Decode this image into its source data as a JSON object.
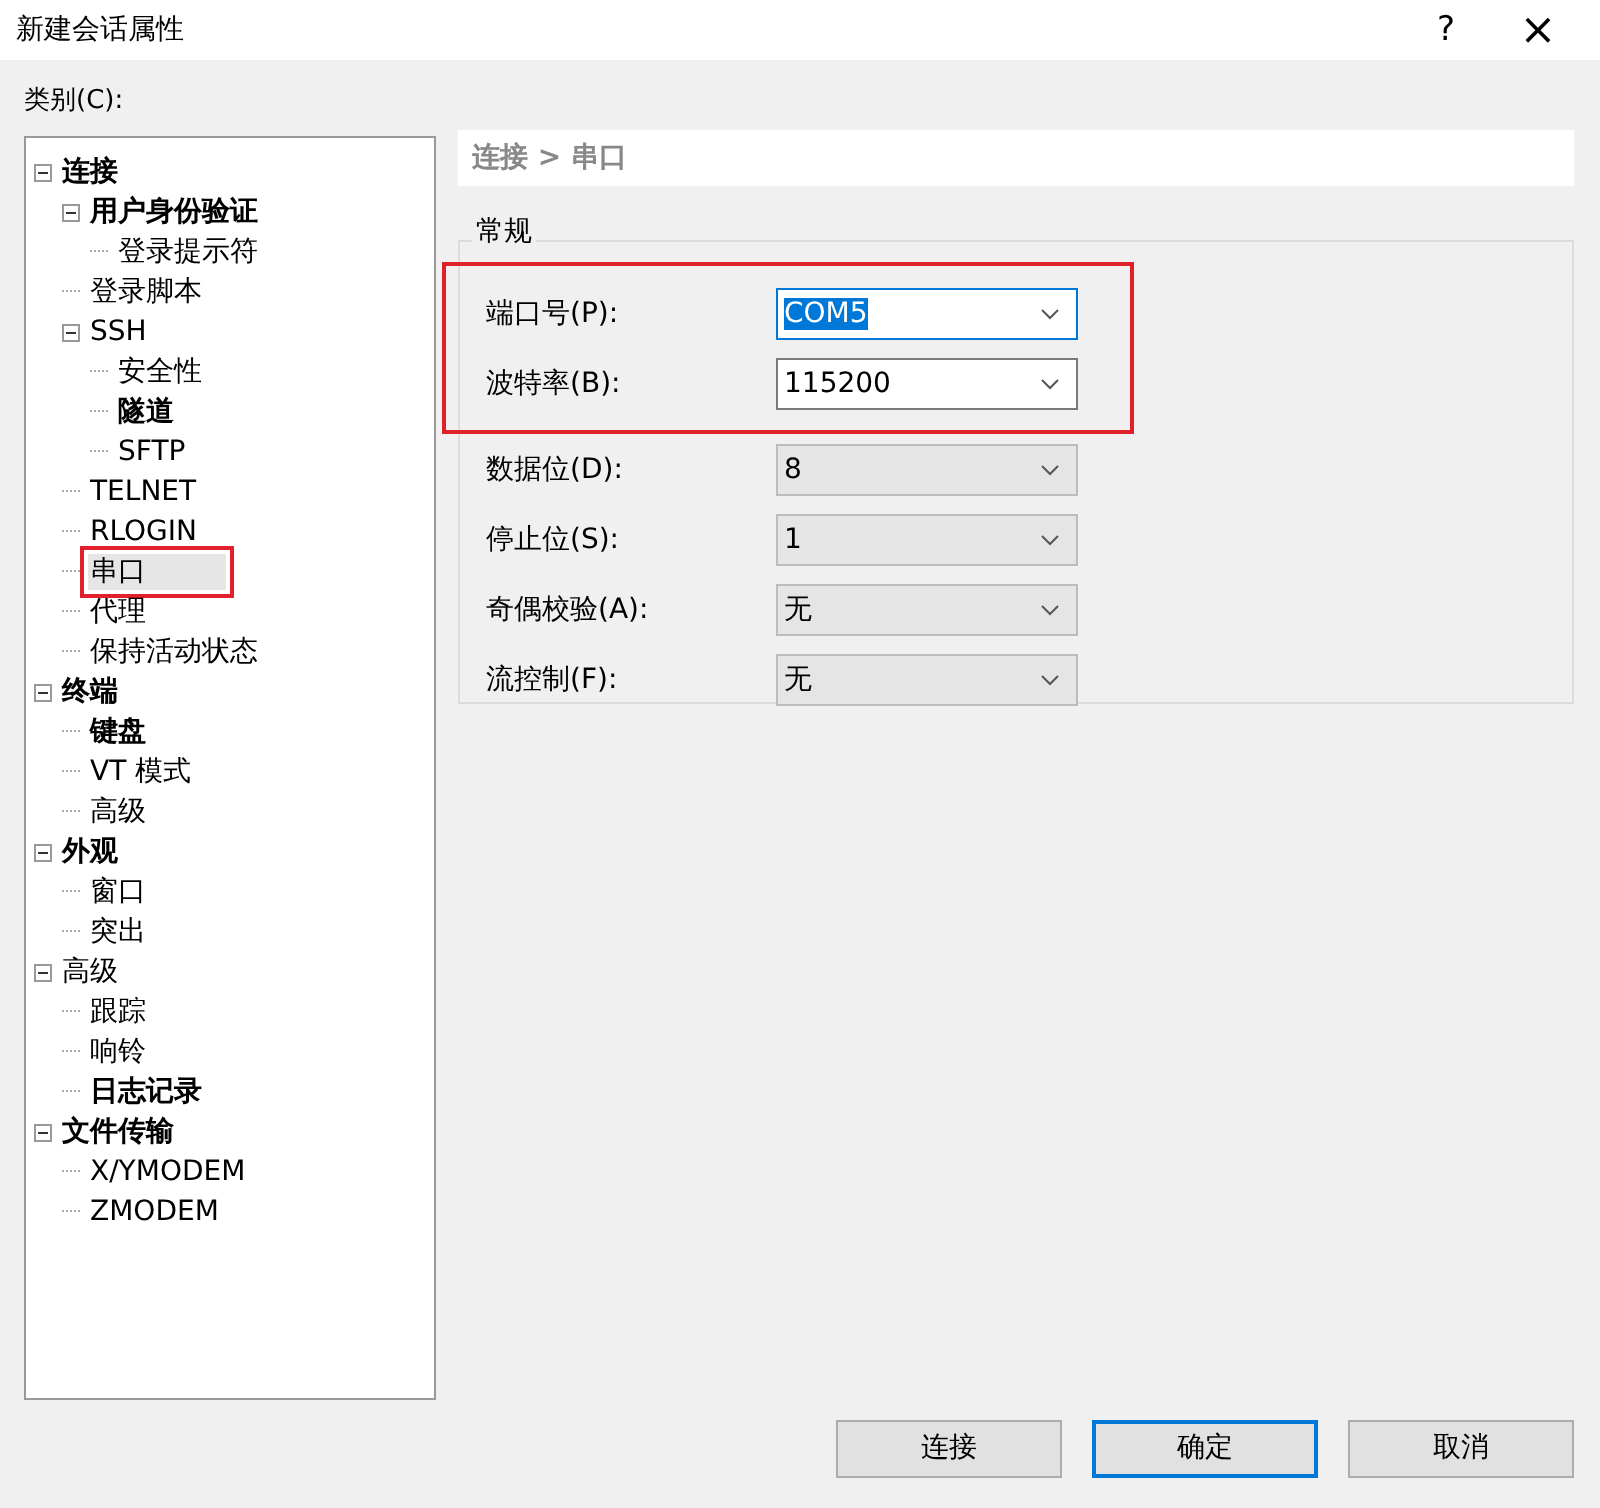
{
  "window": {
    "title": "新建会话属性",
    "help": "?",
    "close": "×"
  },
  "category_label": "类别(C):",
  "tree": [
    {
      "label": "连接",
      "bold": true,
      "expanded": true,
      "selected": false,
      "highlighted": false,
      "children": [
        {
          "label": "用户身份验证",
          "bold": true,
          "expanded": true,
          "selected": false,
          "highlighted": false,
          "children": [
            {
              "label": "登录提示符",
              "bold": false,
              "selected": false,
              "highlighted": false
            }
          ]
        },
        {
          "label": "登录脚本",
          "bold": false,
          "selected": false,
          "highlighted": false
        },
        {
          "label": "SSH",
          "bold": false,
          "expanded": true,
          "selected": false,
          "highlighted": false,
          "children": [
            {
              "label": "安全性",
              "bold": false,
              "selected": false,
              "highlighted": false
            },
            {
              "label": "隧道",
              "bold": true,
              "selected": false,
              "highlighted": false
            },
            {
              "label": "SFTP",
              "bold": false,
              "selected": false,
              "highlighted": false
            }
          ]
        },
        {
          "label": "TELNET",
          "bold": false,
          "selected": false,
          "highlighted": false
        },
        {
          "label": "RLOGIN",
          "bold": false,
          "selected": false,
          "highlighted": false
        },
        {
          "label": "串口",
          "bold": false,
          "selected": true,
          "highlighted": true
        },
        {
          "label": "代理",
          "bold": false,
          "selected": false,
          "highlighted": false
        },
        {
          "label": "保持活动状态",
          "bold": false,
          "selected": false,
          "highlighted": false
        }
      ]
    },
    {
      "label": "终端",
      "bold": true,
      "expanded": true,
      "selected": false,
      "highlighted": false,
      "children": [
        {
          "label": "键盘",
          "bold": true,
          "selected": false,
          "highlighted": false
        },
        {
          "label": "VT 模式",
          "bold": false,
          "selected": false,
          "highlighted": false
        },
        {
          "label": "高级",
          "bold": false,
          "selected": false,
          "highlighted": false
        }
      ]
    },
    {
      "label": "外观",
      "bold": true,
      "expanded": true,
      "selected": false,
      "highlighted": false,
      "children": [
        {
          "label": "窗口",
          "bold": false,
          "selected": false,
          "highlighted": false
        },
        {
          "label": "突出",
          "bold": false,
          "selected": false,
          "highlighted": false
        }
      ]
    },
    {
      "label": "高级",
      "bold": false,
      "expanded": true,
      "selected": false,
      "highlighted": false,
      "children": [
        {
          "label": "跟踪",
          "bold": false,
          "selected": false,
          "highlighted": false
        },
        {
          "label": "响铃",
          "bold": false,
          "selected": false,
          "highlighted": false
        },
        {
          "label": "日志记录",
          "bold": true,
          "selected": false,
          "highlighted": false
        }
      ]
    },
    {
      "label": "文件传输",
      "bold": true,
      "expanded": true,
      "selected": false,
      "highlighted": false,
      "children": [
        {
          "label": "X/YMODEM",
          "bold": false,
          "selected": false,
          "highlighted": false
        },
        {
          "label": "ZMODEM",
          "bold": false,
          "selected": false,
          "highlighted": false
        }
      ]
    }
  ],
  "breadcrumb": "连接 > 串口",
  "group_title": "常规",
  "field_groups": [
    {
      "highlighted": true,
      "fields": [
        {
          "label": "端口号(P):",
          "value": "COM5",
          "editable": true,
          "focused": true,
          "text_selected": true
        },
        {
          "label": "波特率(B):",
          "value": "115200",
          "editable": true,
          "focused": false,
          "text_selected": false
        }
      ]
    },
    {
      "highlighted": false,
      "fields": [
        {
          "label": "数据位(D):",
          "value": "8",
          "editable": false,
          "focused": false,
          "text_selected": false
        },
        {
          "label": "停止位(S):",
          "value": "1",
          "editable": false,
          "focused": false,
          "text_selected": false
        },
        {
          "label": "奇偶校验(A):",
          "value": "无",
          "editable": false,
          "focused": false,
          "text_selected": false
        },
        {
          "label": "流控制(F):",
          "value": "无",
          "editable": false,
          "focused": false,
          "text_selected": false
        }
      ]
    }
  ],
  "buttons": [
    {
      "label": "连接",
      "default": false
    },
    {
      "label": "确定",
      "default": true
    },
    {
      "label": "取消",
      "default": false
    }
  ]
}
